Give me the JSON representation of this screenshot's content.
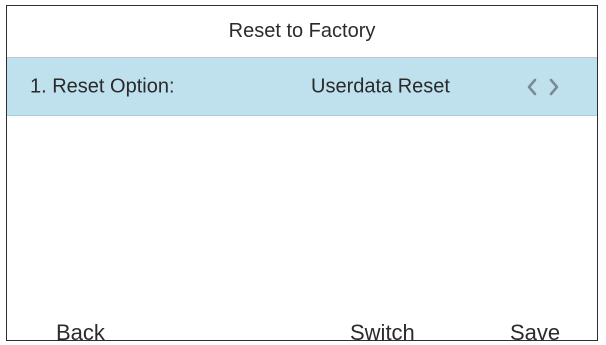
{
  "screen": {
    "title": "Reset to Factory"
  },
  "option": {
    "label": "1. Reset Option:",
    "value": "Userdata Reset",
    "prev_icon": "chevron-left-icon",
    "next_icon": "chevron-right-icon"
  },
  "softkeys": {
    "back": "Back",
    "switch": "Switch",
    "save": "Save"
  },
  "colors": {
    "title_divider": "#bfc7cc",
    "selected_row": "#bfe1ee",
    "arrow": "#7a8a96",
    "text": "#2a2a2a"
  }
}
